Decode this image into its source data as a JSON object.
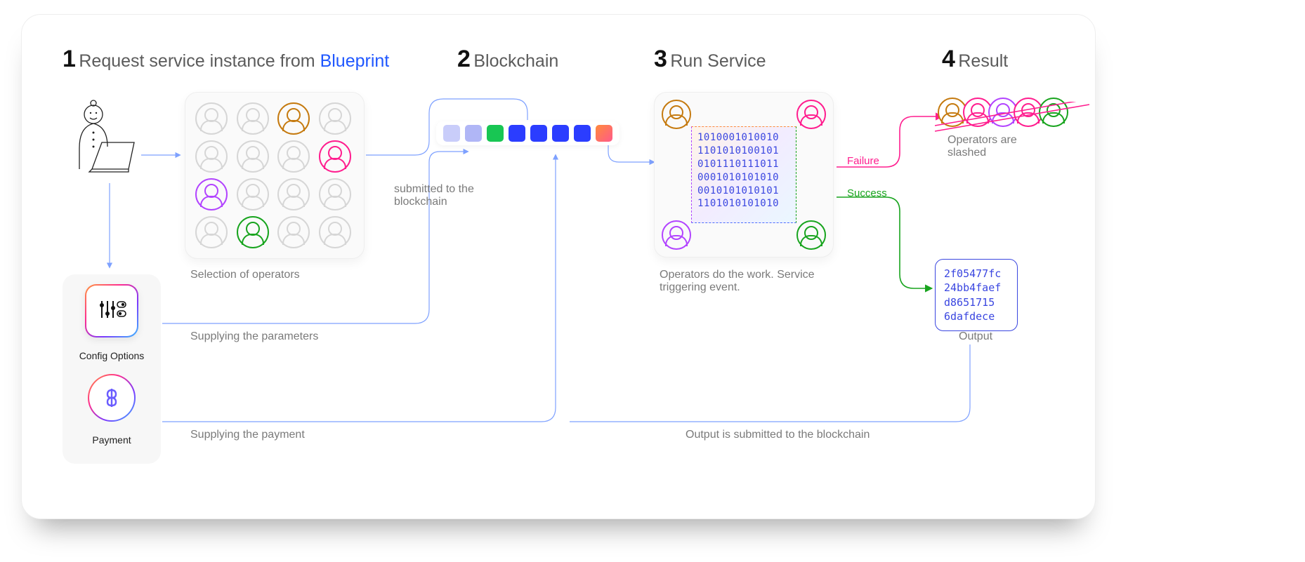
{
  "steps": {
    "s1": {
      "num": "1",
      "title_a": "Request service instance from ",
      "title_b": "Blueprint"
    },
    "s2": {
      "num": "2",
      "title": "Blockchain"
    },
    "s3": {
      "num": "3",
      "title": "Run Service"
    },
    "s4": {
      "num": "4",
      "title": "Result"
    }
  },
  "captions": {
    "selection": "Selection of operators",
    "submitted": "submitted to the blockchain",
    "supply_params": "Supplying the parameters",
    "supply_payment": "Supplying the payment",
    "run_desc": "Operators do the work. Service triggering event.",
    "slashed": "Operators are slashed",
    "output_submitted": "Output is submitted to the blockchain",
    "output_label": "Output"
  },
  "labels": {
    "config": "Config Options",
    "payment": "Payment",
    "failure": "Failure",
    "success": "Success"
  },
  "binary_lines": [
    "1010001010010",
    "1101010100101",
    "0101110111011",
    "0001010101010",
    "0010101010101",
    "1101010101010"
  ],
  "output_hash_lines": [
    "2f05477fc",
    "24bb4faef",
    "d8651715",
    "6dafdece"
  ]
}
